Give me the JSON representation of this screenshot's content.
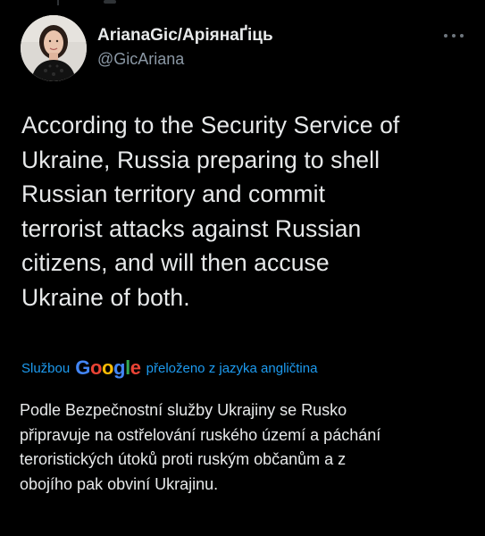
{
  "author": {
    "display_name": "ArianaGic/АріянаҐіць",
    "handle": "@GicAriana"
  },
  "more_icon": "more-horizontal-icon",
  "tweet": {
    "text": "According to the Security Service of\nUkraine, Russia preparing to shell\nRussian territory and commit\nterrorist attacks against Russian\ncitizens, and will then accuse\nUkraine of both."
  },
  "translation": {
    "prefix": "Službou",
    "provider_logo": "Google",
    "suffix": "přeloženo z jazyka angličtina",
    "text": "Podle Bezpečnostní služby Ukrajiny se Rusko\npřipravuje na ostřelování ruského území a páchání\nteroristických útoků proti ruským občanům a z\nobojího pak obviní Ukrajinu."
  },
  "colors": {
    "background": "#000000",
    "primary_text": "#e7e9ea",
    "secondary_text": "#8b98a5",
    "link_blue": "#1d9bf0"
  }
}
